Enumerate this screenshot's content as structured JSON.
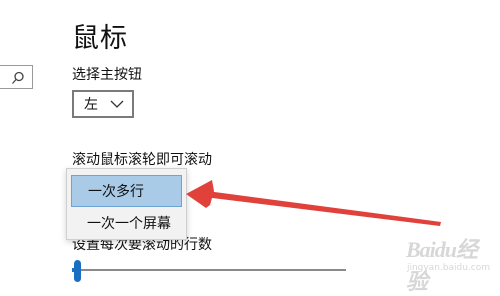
{
  "page": {
    "title": "鼠标"
  },
  "primary_button": {
    "label": "选择主按钮",
    "selected_value": "左"
  },
  "scroll": {
    "label": "滚动鼠标滚轮即可滚动",
    "options": [
      "一次多行",
      "一次一个屏幕"
    ],
    "selected_index": 0
  },
  "lines": {
    "label": "设置每次要滚动的行数",
    "slider_fraction": 0.01
  },
  "colors": {
    "accent": "#1a6ec2",
    "selection": "#a9cbe8",
    "annotation_arrow": "#e0413b"
  },
  "watermark": {
    "text": "Baidu经验",
    "subtext": "jingyan.baidu.com"
  },
  "icons": {
    "search": "search-icon",
    "dropdown": "chevron-down-icon"
  }
}
